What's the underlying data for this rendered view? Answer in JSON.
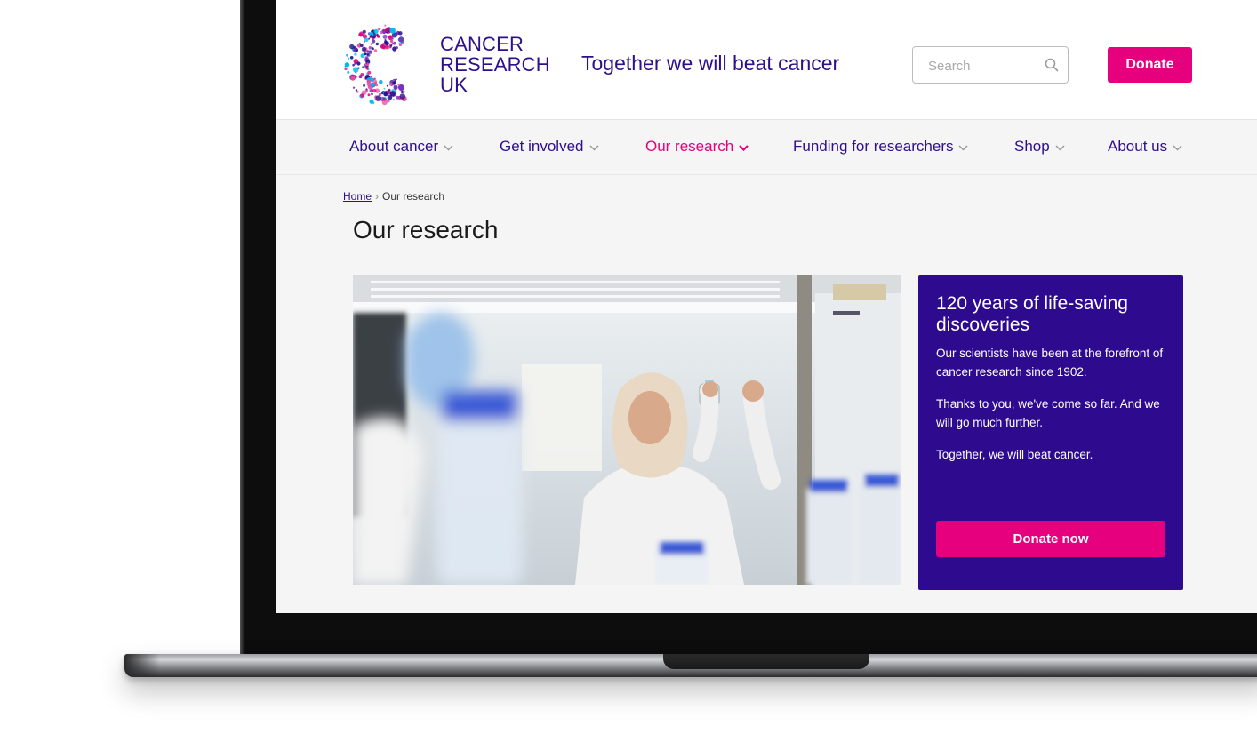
{
  "brand": {
    "logo_lines": [
      "CANCER",
      "RESEARCH",
      "UK"
    ],
    "tagline": "Together we will beat cancer",
    "colors": {
      "primary": "#2e0f8c",
      "accent": "#e6007e",
      "promo_bg": "#2e0a8f"
    }
  },
  "header": {
    "search": {
      "placeholder": "Search",
      "value": "",
      "icon": "search-icon"
    },
    "donate_label": "Donate"
  },
  "nav": {
    "items": [
      {
        "label": "About cancer"
      },
      {
        "label": "Get involved"
      },
      {
        "label": "Our research",
        "active": true
      },
      {
        "label": "Funding for researchers"
      },
      {
        "label": "Shop"
      },
      {
        "label": "About us"
      }
    ]
  },
  "breadcrumb": {
    "home": "Home",
    "separator": "›",
    "current": "Our research"
  },
  "page": {
    "title": "Our research"
  },
  "promo": {
    "heading": "120 years of life-saving discoveries",
    "paragraphs": [
      "Our scientists have been at the forefront of cancer research since 1902.",
      "Thanks to you, we've come so far. And we will go much further.",
      "Together, we will beat cancer."
    ],
    "button_label": "Donate now"
  }
}
